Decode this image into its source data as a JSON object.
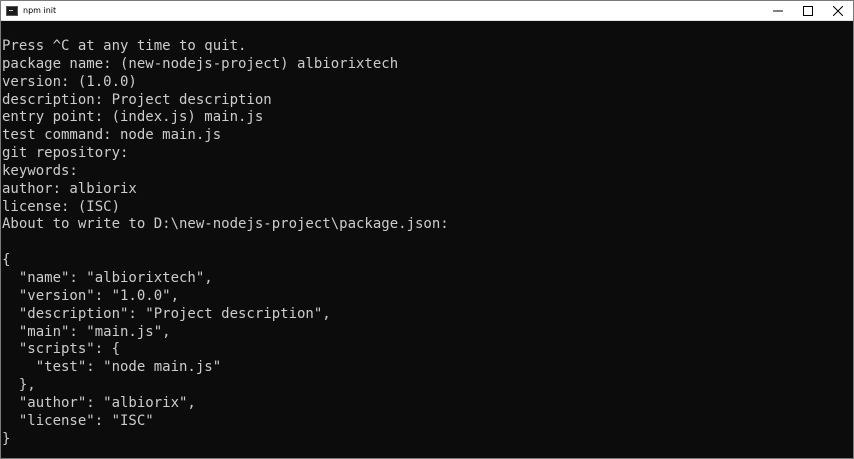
{
  "window": {
    "title": "npm init",
    "minimize_icon": "minimize-icon",
    "maximize_icon": "maximize-icon",
    "close_icon": "close-icon"
  },
  "console": {
    "lines": [
      "Press ^C at any time to quit.",
      "package name: (new-nodejs-project) albiorixtech",
      "version: (1.0.0)",
      "description: Project description",
      "entry point: (index.js) main.js",
      "test command: node main.js",
      "git repository:",
      "keywords:",
      "author: albiorix",
      "license: (ISC)",
      "About to write to D:\\new-nodejs-project\\package.json:",
      "",
      "{",
      "  \"name\": \"albiorixtech\",",
      "  \"version\": \"1.0.0\",",
      "  \"description\": \"Project description\",",
      "  \"main\": \"main.js\",",
      "  \"scripts\": {",
      "    \"test\": \"node main.js\"",
      "  },",
      "  \"author\": \"albiorix\",",
      "  \"license\": \"ISC\"",
      "}"
    ]
  },
  "colors": {
    "background": "#0c0c0c",
    "text": "#cccccc",
    "titlebar": "#ffffff"
  }
}
